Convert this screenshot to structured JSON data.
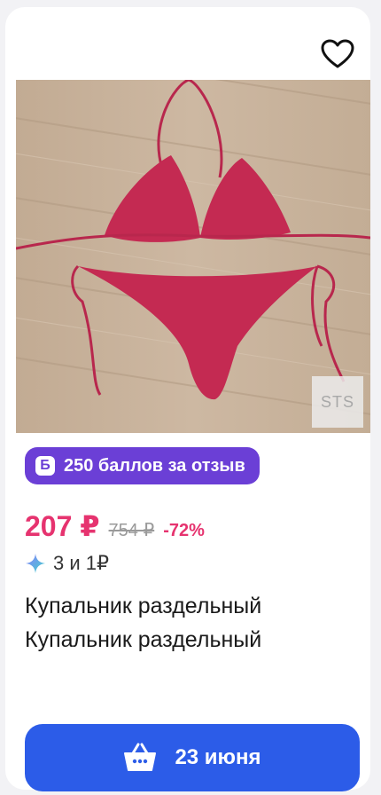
{
  "product": {
    "watermark": "STS",
    "badge": {
      "icon": "Б",
      "text": "250 баллов за отзыв"
    },
    "price": {
      "current": "207 ₽",
      "old": "754 ₽",
      "discount": "-72%"
    },
    "promo": {
      "text": "3 и 1₽",
      "icon": "sparkle-icon"
    },
    "title_line1": "Купальник раздельный",
    "title_line2": "Купальник раздельный",
    "cart": {
      "label": "23 июня",
      "icon": "basket-icon"
    }
  },
  "colors": {
    "price": "#e6336f",
    "badge": "#6b3fd6",
    "button": "#2c5ce8",
    "swimsuit": "#c42a52"
  }
}
